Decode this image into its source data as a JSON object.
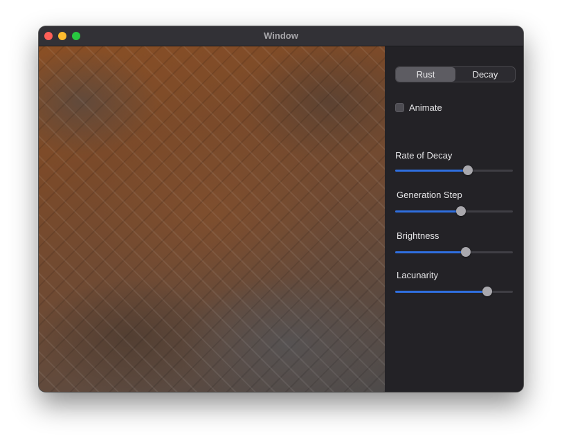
{
  "window": {
    "title": "Window"
  },
  "segmented_control": {
    "options": [
      "Rust",
      "Decay"
    ],
    "selected": "Rust"
  },
  "animate": {
    "label": "Animate",
    "checked": false
  },
  "sliders": [
    {
      "label": "Rate of Decay",
      "value": 0.62
    },
    {
      "label": "Generation Step",
      "value": 0.56
    },
    {
      "label": "Brightness",
      "value": 0.6
    },
    {
      "label": "Lacunarity",
      "value": 0.78
    }
  ],
  "colors": {
    "accent": "#2f6fe0",
    "sidebar_bg": "#232226",
    "titlebar_bg": "#323136"
  }
}
